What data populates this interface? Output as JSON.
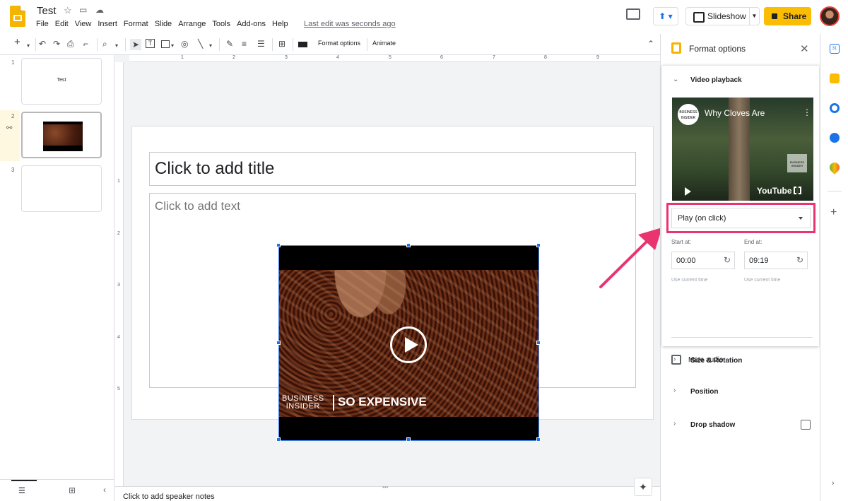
{
  "app": {
    "title": "Test",
    "menu": [
      "File",
      "Edit",
      "View",
      "Insert",
      "Format",
      "Slide",
      "Arrange",
      "Tools",
      "Add-ons",
      "Help"
    ],
    "last_edit": "Last edit was seconds ago",
    "slideshow_label": "Slideshow",
    "share_label": "Share"
  },
  "toolbar": {
    "format_options": "Format options",
    "animate": "Animate"
  },
  "filmstrip": {
    "slides": [
      {
        "number": "1",
        "title": "Test"
      },
      {
        "number": "2",
        "title": ""
      },
      {
        "number": "3",
        "title": ""
      }
    ],
    "selected": 2
  },
  "rulers": {
    "top": [
      "1",
      "2",
      "3",
      "4",
      "5",
      "6",
      "7",
      "8",
      "9"
    ],
    "left": [
      "1",
      "2",
      "3",
      "4",
      "5"
    ]
  },
  "slide": {
    "title_placeholder": "Click to add title",
    "body_placeholder": "Click to add text",
    "video": {
      "brand": "BUSINESS INSIDER",
      "brand_line1": "BUSINESS",
      "brand_line2": "INSIDER",
      "series": "SO EXPENSIVE"
    }
  },
  "notes": {
    "placeholder": "Click to add speaker notes"
  },
  "panel": {
    "title": "Format options",
    "sections": {
      "video_playback": "Video playback",
      "size_rotation": "Size & Rotation",
      "position": "Position",
      "drop_shadow": "Drop shadow"
    },
    "preview": {
      "video_title": "Why Cloves Are",
      "channel_badge_line1": "BUSINESS",
      "channel_badge_line2": "INSIDER",
      "platform": "YouTube"
    },
    "playback_mode": "Play (on click)",
    "start_label": "Start at:",
    "start_value": "00:00",
    "end_label": "End at:",
    "end_value": "09:19",
    "use_current": "Use current time",
    "mute_label": "Mute audio",
    "mute_checked": false,
    "drop_shadow_checked": false
  },
  "colors": {
    "accent_blue": "#1a73e8",
    "share_yellow": "#fbbc04",
    "highlight_pink": "#ea3470"
  }
}
